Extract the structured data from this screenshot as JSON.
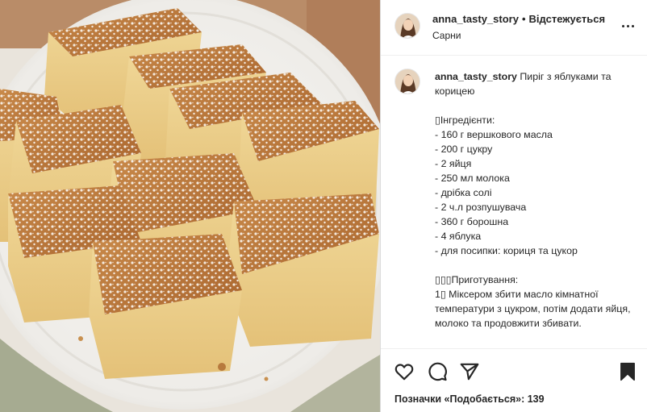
{
  "post": {
    "image_alt": "Пиріг з яблуками та корицею",
    "header": {
      "username": "anna_tasty_story",
      "separator": "•",
      "follow_status": "Відстежується",
      "location": "Сарни"
    },
    "caption": {
      "username": "anna_tasty_story",
      "title": "Пиріг з яблуками та корицею",
      "lines": [
        "",
        "▯Інгредієнти:",
        "- 160 г вершкового масла",
        "- 200 г цукру",
        "- 2 яйця",
        "- 250 мл молока",
        "- дрібка солі",
        "- 2 ч.л розпушувача",
        "- 360 г борошна",
        "- 4 яблука",
        "- для посипки: кориця та цукор",
        "",
        "▯▯▯Приготування:",
        "1▯ Міксером збити масло кімнатної температури з цукром, потім додати яйця, молоко та продовжити збивати."
      ]
    },
    "actions": {
      "like_icon": "heart-icon",
      "comment_icon": "comment-icon",
      "share_icon": "paper-plane-icon",
      "save_icon": "bookmark-icon"
    },
    "likes_text": "Позначки «Подобається»: 139"
  },
  "colors": {
    "text": "#262626",
    "border": "#dbdbdb",
    "background": "#ffffff"
  }
}
